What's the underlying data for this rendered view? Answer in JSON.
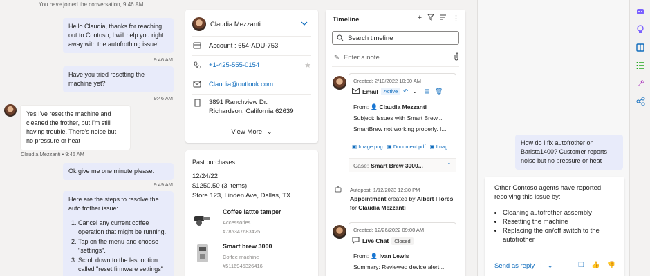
{
  "chat": {
    "system_note": "You have joined the conversation, 9:46 AM",
    "messages": [
      {
        "text": "Hello Claudia, thanks for reaching out to Contoso, I will help you right away with the autofrothing issue!",
        "time": "9:46 AM"
      },
      {
        "text": "Have you tried resetting the machine yet?",
        "time": "9:46 AM"
      },
      {
        "text": "Yes I've reset the machine and cleaned the frother, but I'm still having trouble. There's noise but no pressure or heat",
        "sender_time": "Claudia Mezzanti • 9:46 AM"
      },
      {
        "text": "Ok give me one minute please.",
        "time": "9:49 AM"
      },
      {
        "intro": "Here are the steps to resolve the auto frother issue:",
        "steps": [
          "Cancel any current coffee operation that might be running.",
          "Tap on the menu and choose \"settings\".",
          "Scroll down to the last option called \"reset firmware settings\""
        ]
      }
    ]
  },
  "contact": {
    "name": "Claudia Mezzanti",
    "account": "Account : 654-ADU-753",
    "phone": "+1-425-555-0154",
    "email": "Claudia@outlook.com",
    "address_line1": "3891 Ranchview Dr.",
    "address_line2": "Richardson, California 62639",
    "view_more": "View More"
  },
  "purchases": {
    "title": "Past purchases",
    "date": "12/24/22",
    "amount": "$1250.50 (3 items)",
    "store": "Store 123, Linden Ave, Dallas, TX",
    "items": [
      {
        "name": "Coffee lattte tamper",
        "category": "Accessories",
        "id": "#785347683425"
      },
      {
        "name": "Smart brew 3000",
        "category": "Coffee machine",
        "id": "#5116945326416"
      }
    ]
  },
  "timeline": {
    "title": "Timeline",
    "search_placeholder": "Search timeline",
    "note_placeholder": "Enter a note...",
    "email": {
      "created": "Created: 2/10/2022 10:00 AM",
      "type": "Email",
      "status": "Active",
      "from_label": "From:",
      "from": "Claudia Mezzanti",
      "subject": "Subject: Issues with Smart Brew...",
      "body": "SmartBrew not working properly. I...",
      "attachments": [
        "Image.png",
        "Document.pdf",
        "Imag"
      ],
      "case_label": "Case:",
      "case": "Smart Brew 3000..."
    },
    "autopost": {
      "header": "Autopost: 1/12/2023 12:30 PM",
      "title": "Appointment",
      "created_by_text": "created by",
      "created_by": "Albert Flores",
      "for_text": "for",
      "for": "Claudia Mezzanti"
    },
    "livechat": {
      "created": "Created: 12/26/2022 09:00 AM",
      "type": "Live Chat",
      "status": "Closed",
      "from_label": "From:",
      "from": "Ivan Lewis",
      "summary": "Summary: Reviewed device alert..."
    }
  },
  "copilot": {
    "question": "How do I fix autofrother on Barista1400? Customer reports noise but no pressure or heat",
    "answer_intro": "Other Contoso agents have reported resolving this issue by:",
    "answer_items": [
      "Cleaning autofrother assembly",
      "Resetting the machine",
      "Replacing the on/off switch to the autofrother"
    ],
    "send_as_reply": "Send as reply"
  },
  "colors": {
    "accent": "#0f6cbd",
    "agent_bubble": "#e8ebfa",
    "rail_icon": "#7b61ff"
  }
}
